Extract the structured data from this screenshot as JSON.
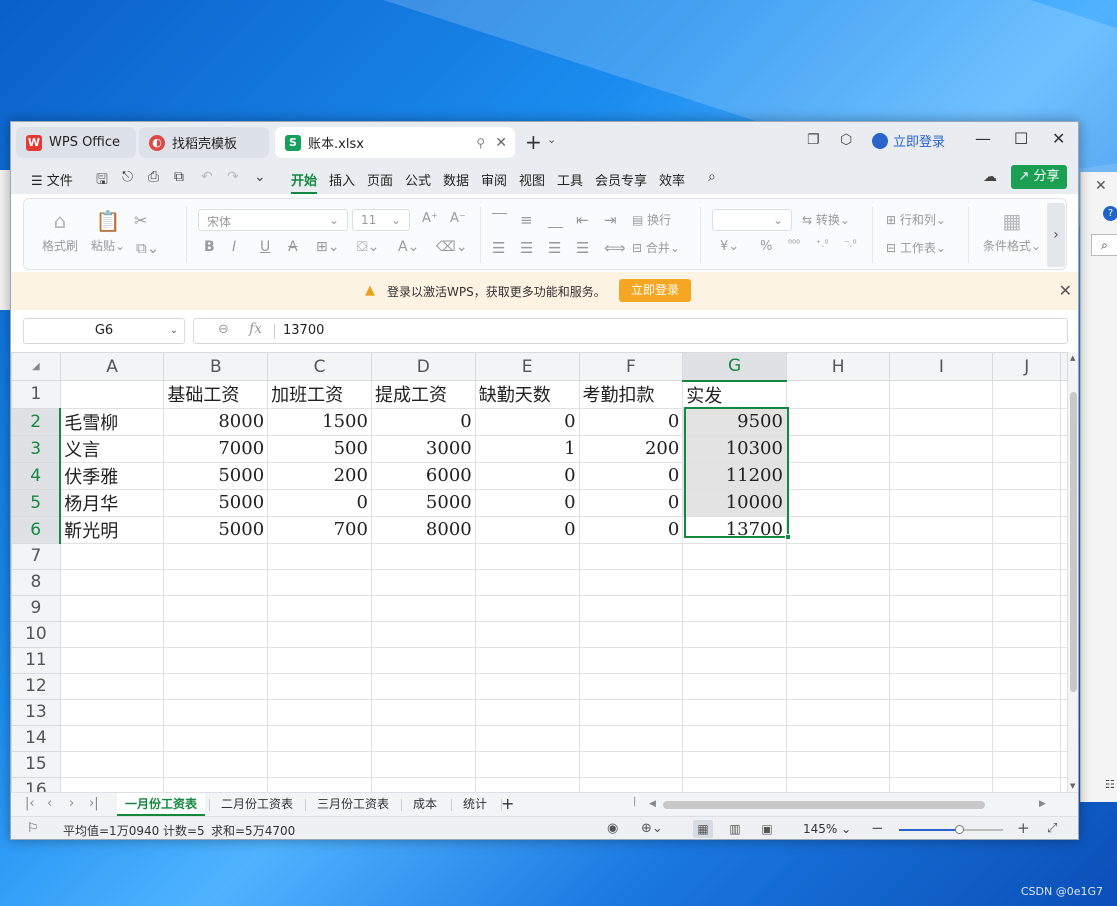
{
  "desktop": {
    "watermark": "CSDN @0e1G7"
  },
  "tabs": [
    {
      "label": "WPS Office",
      "icon": "wps-logo-icon"
    },
    {
      "label": "找稻壳模板",
      "icon": "docer-icon"
    },
    {
      "label": "账本.xlsx",
      "icon": "spreadsheet-icon"
    }
  ],
  "header": {
    "login_label": "立即登录",
    "share_label": "分享"
  },
  "menu": {
    "file": "文件",
    "items": [
      "开始",
      "插入",
      "页面",
      "公式",
      "数据",
      "审阅",
      "视图",
      "工具",
      "会员专享",
      "效率"
    ],
    "active": "开始"
  },
  "ribbon": {
    "format_painter": "格式刷",
    "paste": "粘贴",
    "font_name": "宋体",
    "font_size": "11",
    "wrap": "换行",
    "merge": "合并",
    "convert": "转换",
    "rows_cols": "行和列",
    "worksheet": "工作表",
    "cond_format": "条件格式"
  },
  "banner": {
    "message": "登录以激活WPS，获取更多功能和服务。",
    "button": "立即登录"
  },
  "formula_bar": {
    "cell_ref": "G6",
    "value": "13700"
  },
  "sheet": {
    "columns": [
      "A",
      "B",
      "C",
      "D",
      "E",
      "F",
      "G",
      "H",
      "I",
      "J"
    ],
    "selected_column": "G",
    "row_numbers": [
      "1",
      "2",
      "3",
      "4",
      "5",
      "6",
      "7",
      "8",
      "9",
      "10",
      "11",
      "12",
      "13",
      "14",
      "15",
      "16"
    ],
    "headers": [
      "",
      "基础工资",
      "加班工资",
      "提成工资",
      "缺勤天数",
      "考勤扣款",
      "实发"
    ],
    "rows": [
      [
        "毛雪柳",
        "8000",
        "1500",
        "0",
        "0",
        "0",
        "9500"
      ],
      [
        "义言",
        "7000",
        "500",
        "3000",
        "1",
        "200",
        "10300"
      ],
      [
        "伏季雅",
        "5000",
        "200",
        "6000",
        "0",
        "0",
        "11200"
      ],
      [
        "杨月华",
        "5000",
        "0",
        "5000",
        "0",
        "0",
        "10000"
      ],
      [
        "靳光明",
        "5000",
        "700",
        "8000",
        "0",
        "0",
        "13700"
      ]
    ]
  },
  "sheet_tabs": [
    "一月份工资表",
    "二月份工资表",
    "三月份工资表",
    "成本",
    "统计"
  ],
  "active_sheet": "一月份工资表",
  "status": {
    "average": "平均值=1万0940",
    "count": "计数=5",
    "sum": "求和=5万4700",
    "zoom": "145%",
    "zoom_level": 0.58
  },
  "colors": {
    "accent": "#13883e",
    "share": "#1a9f53",
    "banner_btn": "#f5a623",
    "link": "#2a63c9"
  }
}
